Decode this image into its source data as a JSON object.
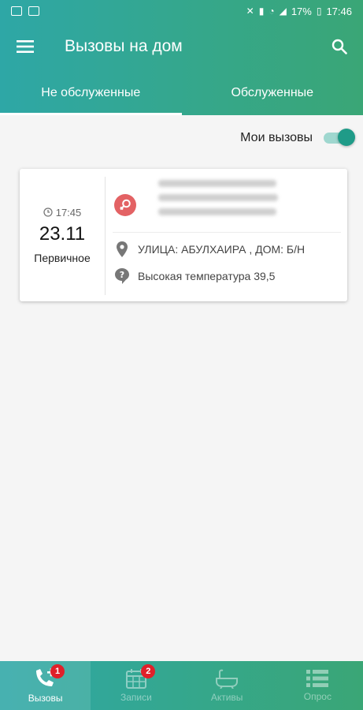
{
  "status_bar": {
    "battery": "17%",
    "time": "17:46"
  },
  "toolbar": {
    "title": "Вызовы на дом"
  },
  "tabs": [
    {
      "label": "Не обслуженные",
      "active": true
    },
    {
      "label": "Обслуженные",
      "active": false
    }
  ],
  "filter": {
    "my_calls_label": "Мои вызовы",
    "my_calls_on": true
  },
  "call_card": {
    "time": "17:45",
    "date": "23.11",
    "type": "Первичное",
    "address": "УЛИЦА: АБУЛХАИРА , ДОМ: Б/Н",
    "reason": "Высокая температура 39,5",
    "gender_icon": "female-icon"
  },
  "bottom_nav": [
    {
      "label": "Вызовы",
      "badge": "1",
      "icon": "phone-add-icon",
      "active": true
    },
    {
      "label": "Записи",
      "badge": "2",
      "icon": "calendar-icon",
      "active": false
    },
    {
      "label": "Активы",
      "badge": "",
      "icon": "bath-icon",
      "active": false
    },
    {
      "label": "Опрос",
      "badge": "",
      "icon": "list-icon",
      "active": false
    }
  ],
  "colors": {
    "accent": "#2ea7a6",
    "accent_end": "#3aa676",
    "badge": "#e0202a",
    "female": "#e36264"
  }
}
